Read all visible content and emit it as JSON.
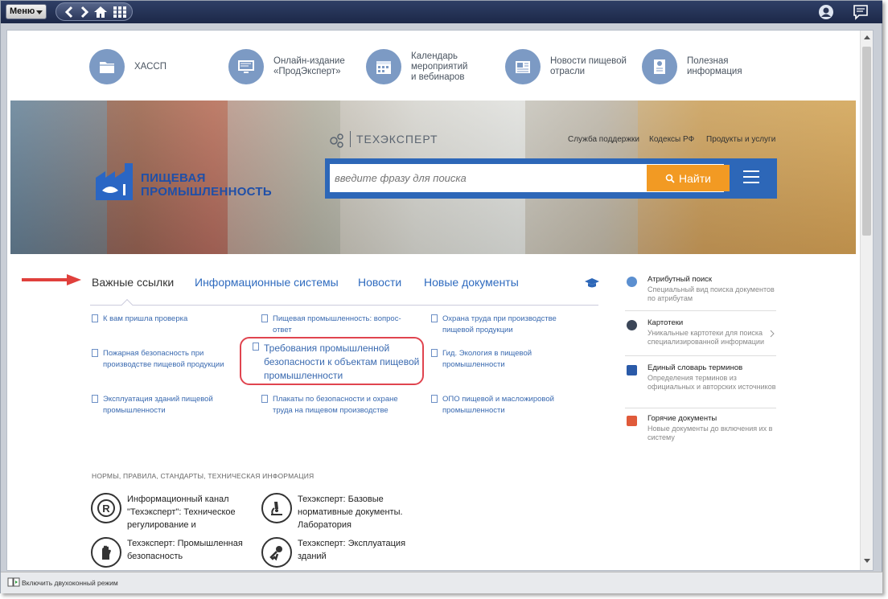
{
  "toolbar": {
    "menu_label": "Меню"
  },
  "quick_links": [
    {
      "label": "ХАССП",
      "icon": "folder-icon"
    },
    {
      "label": "Онлайн-издание\n«ПродЭксперт»",
      "icon": "monitor-icon"
    },
    {
      "label": "Календарь\nмероприятий\nи вебинаров",
      "icon": "calendar-icon"
    },
    {
      "label": "Новости пищевой\nотрасли",
      "icon": "newspaper-icon"
    },
    {
      "label": "Полезная\nинформация",
      "icon": "info-doc-icon"
    }
  ],
  "banner": {
    "logo_line1": "ПИЩЕВАЯ",
    "logo_line2": "ПРОМЫШЛЕННОСТЬ",
    "brand": "ТЕХЭКСПЕРТ",
    "top_links": [
      "Служба поддержки",
      "Кодексы РФ",
      "Продукты и услуги"
    ],
    "search_placeholder": "введите фразу для поиска",
    "search_button": "Найти"
  },
  "tabs": [
    "Важные ссылки",
    "Информационные системы",
    "Новости",
    "Новые документы"
  ],
  "docs": [
    "К вам пришла проверка",
    "Пищевая промышленность: вопрос-ответ",
    "Охрана труда при производстве пищевой продукции",
    "Пожарная безопасность при производстве пищевой продукции",
    "Требования промышленной безопасности к объектам пищевой промышленности",
    "Гид. Экология в пищевой промышленности",
    "Эксплуатация зданий пищевой промышленности",
    "Плакаты по безопасности и охране труда на пищевом производстве",
    "ОПО пищевой и масложировой промышленности"
  ],
  "section_title": "НОРМЫ, ПРАВИЛА, СТАНДАРТЫ, ТЕХНИЧЕСКАЯ ИНФОРМАЦИЯ",
  "products": [
    "Информационный канал \"Техэксперт\": Техническое регулирование и",
    "Техэксперт: Базовые нормативные документы. Лаборатория",
    "Техэксперт: Промышленная безопасность",
    "Техэксперт: Эксплуатация зданий"
  ],
  "sidebar": [
    {
      "title": "Атрибутный поиск",
      "desc": "Специальный вид поиска документов по атрибутам",
      "color": "#5b8fd0"
    },
    {
      "title": "Картотеки",
      "desc": "Уникальные картотеки для поиска специализированной информации",
      "color": "#3b4658"
    },
    {
      "title": "Единый словарь терминов",
      "desc": "Определения терминов из официальных и авторских источников",
      "color": "#2a5aa8"
    },
    {
      "title": "Горячие документы",
      "desc": "Новые документы до включения их в систему",
      "color": "#e05a3a"
    }
  ],
  "status": {
    "dual_window": "Включить двухоконный режим"
  }
}
